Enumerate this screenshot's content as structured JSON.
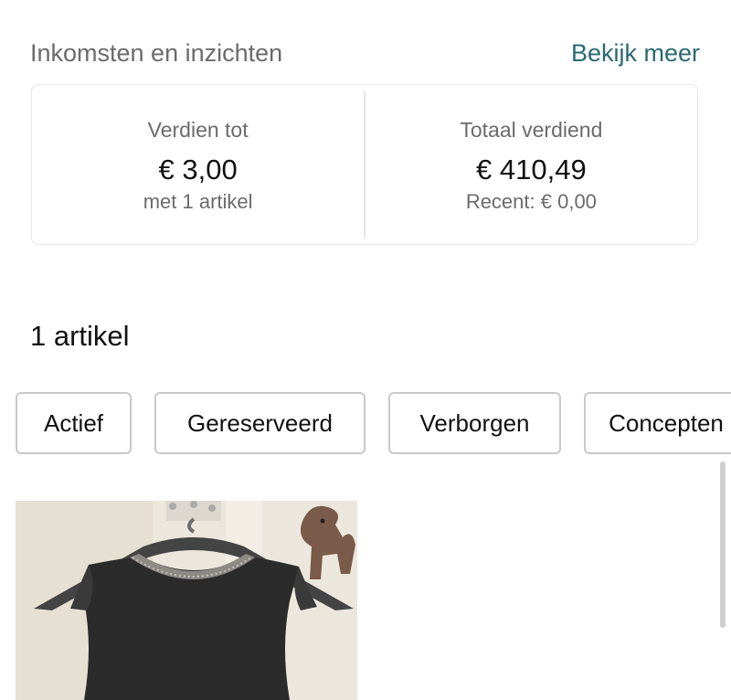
{
  "header": {
    "title": "Inkomsten en inzichten",
    "link": "Bekijk meer"
  },
  "stats": {
    "left": {
      "label": "Verdien tot",
      "value": "€ 3,00",
      "sub": "met 1 artikel"
    },
    "right": {
      "label": "Totaal verdiend",
      "value": "€ 410,49",
      "sub": "Recent: € 0,00"
    }
  },
  "items": {
    "count_label": "1 artikel"
  },
  "filters": [
    "Actief",
    "Gereserveerd",
    "Verborgen",
    "Concepten"
  ],
  "colors": {
    "accent": "#2a6a71",
    "muted_text": "#6b6b6b",
    "border": "#c9c9c9"
  },
  "product": {
    "image_description": "black sleeveless top with sparkly collar on hanger",
    "icons": [
      "hanger-icon"
    ]
  }
}
